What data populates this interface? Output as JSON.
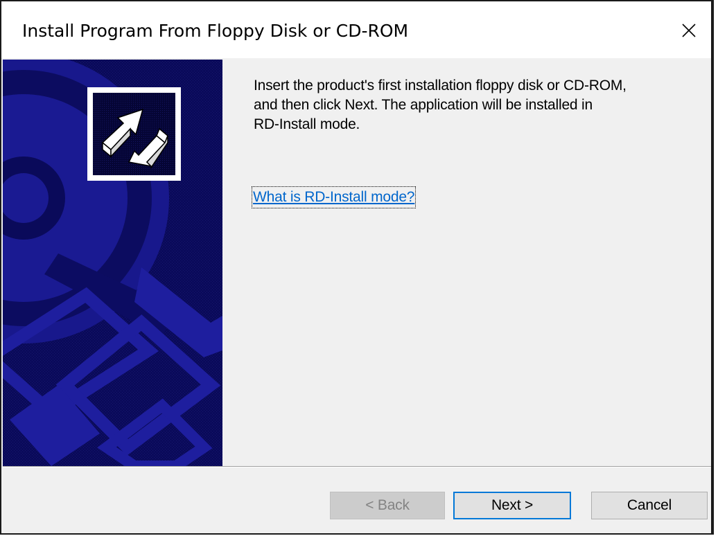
{
  "window": {
    "title": "Install Program From Floppy Disk or CD-ROM"
  },
  "titlebar_icons": {
    "close": "close-icon"
  },
  "banner": {
    "icon": "install-arrow-icon",
    "background_color": "#0a0a5a",
    "accent_color": "#1e1e9e"
  },
  "content": {
    "instructions_line1": "Insert the product's first installation floppy disk or CD-ROM,",
    "instructions_line2": "and then click Next. The application will be installed in",
    "instructions_line3": "RD-Install mode.",
    "help_link": "What is RD-Install mode?"
  },
  "footer": {
    "back_label": "< Back",
    "back_enabled": false,
    "next_label": "Next >",
    "cancel_label": "Cancel"
  },
  "colors": {
    "link": "#0066cc",
    "focus_border": "#0078d7",
    "disabled_text": "#838383"
  }
}
